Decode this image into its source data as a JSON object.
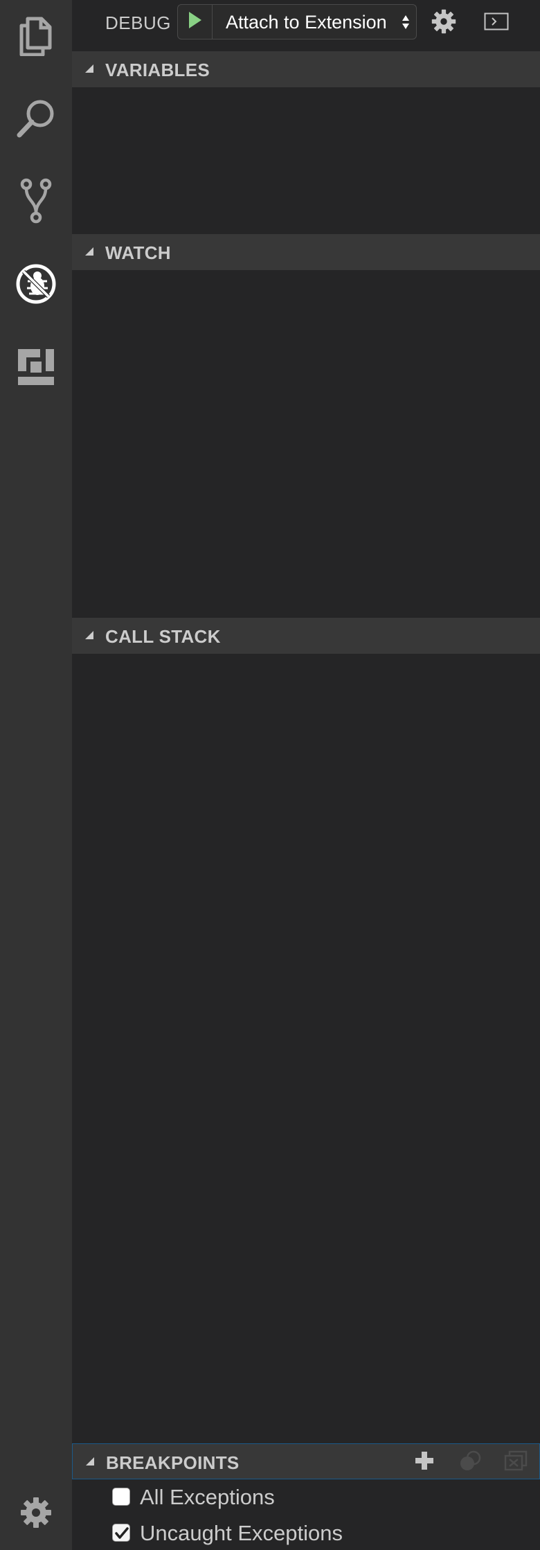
{
  "activity_bar": {
    "items": [
      {
        "name": "explorer",
        "icon": "files-icon",
        "active": false
      },
      {
        "name": "search",
        "icon": "search-icon",
        "active": false
      },
      {
        "name": "scm",
        "icon": "source-control-icon",
        "active": false
      },
      {
        "name": "debug",
        "icon": "debug-icon",
        "active": true
      },
      {
        "name": "extensions",
        "icon": "extensions-icon",
        "active": false
      }
    ],
    "bottom_icon": "gear-icon"
  },
  "debug": {
    "title": "DEBUG",
    "configuration": "Attach to Extension"
  },
  "sections": {
    "variables": "VARIABLES",
    "watch": "WATCH",
    "call_stack": "CALL STACK",
    "breakpoints": "BREAKPOINTS"
  },
  "breakpoints": [
    {
      "label": "All Exceptions",
      "checked": false
    },
    {
      "label": "Uncaught Exceptions",
      "checked": true
    }
  ],
  "colors": {
    "activity_bar": "#333333",
    "sidebar": "#252526",
    "section_header": "#383838",
    "start_green": "#89d185",
    "focus_border": "#1b5a89"
  }
}
